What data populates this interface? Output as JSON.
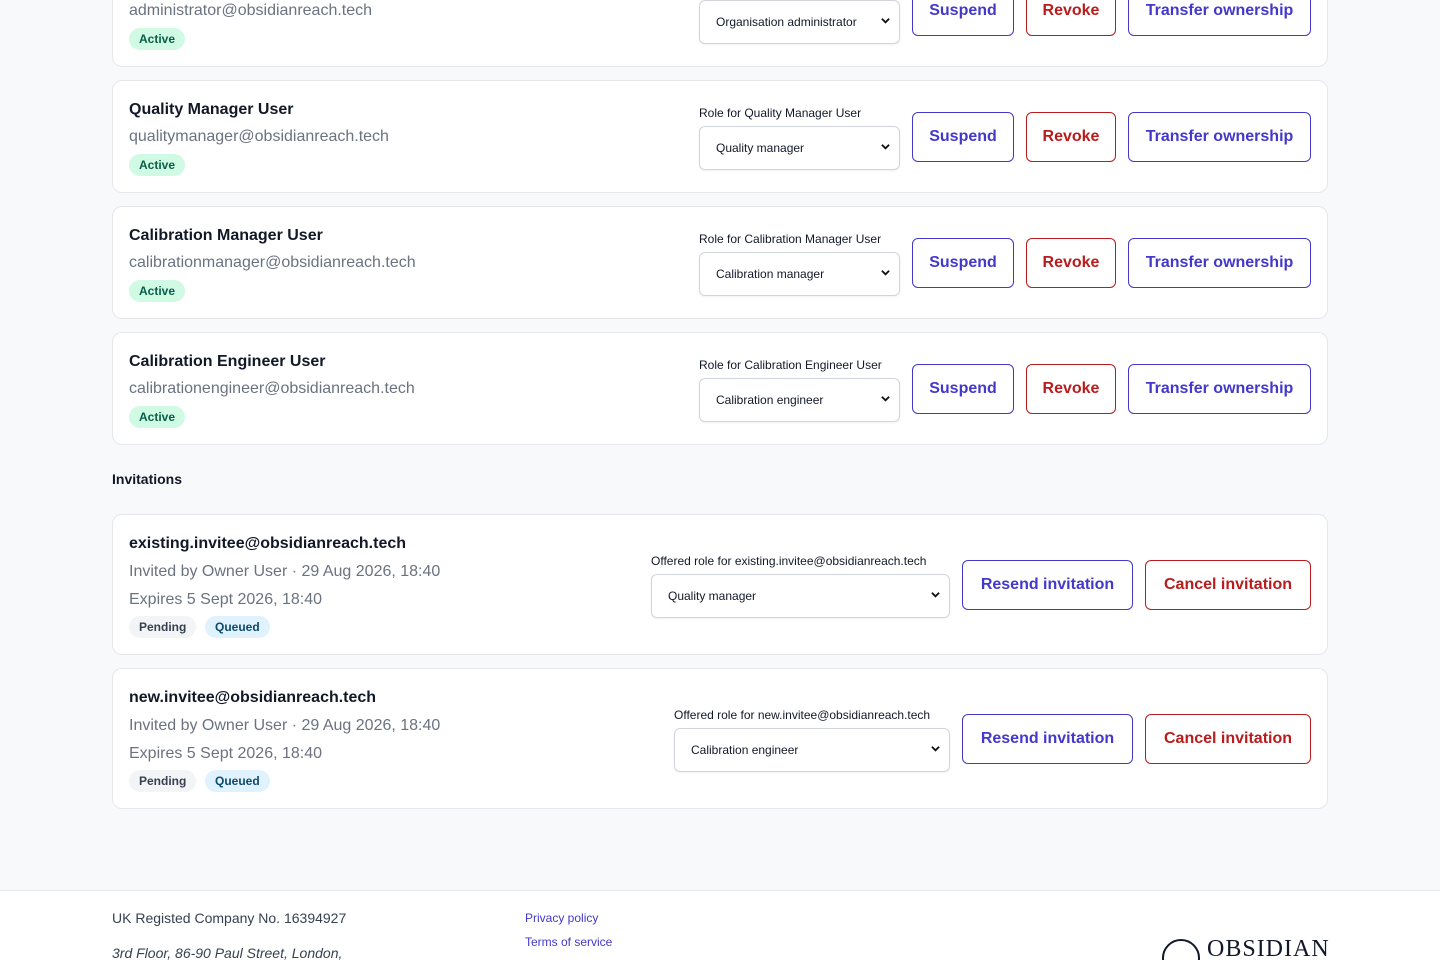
{
  "members": [
    {
      "name": "",
      "email": "administrator@obsidianreach.tech",
      "status": "Active",
      "role_label": "",
      "role": "Organisation administrator",
      "suspend": "Suspend",
      "revoke": "Revoke",
      "transfer": "Transfer ownership"
    },
    {
      "name": "Quality Manager User",
      "email": "qualitymanager@obsidianreach.tech",
      "status": "Active",
      "role_label": "Role for Quality Manager User",
      "role": "Quality manager",
      "suspend": "Suspend",
      "revoke": "Revoke",
      "transfer": "Transfer ownership"
    },
    {
      "name": "Calibration Manager User",
      "email": "calibrationmanager@obsidianreach.tech",
      "status": "Active",
      "role_label": "Role for Calibration Manager User",
      "role": "Calibration manager",
      "suspend": "Suspend",
      "revoke": "Revoke",
      "transfer": "Transfer ownership"
    },
    {
      "name": "Calibration Engineer User",
      "email": "calibrationengineer@obsidianreach.tech",
      "status": "Active",
      "role_label": "Role for Calibration Engineer User",
      "role": "Calibration engineer",
      "suspend": "Suspend",
      "revoke": "Revoke",
      "transfer": "Transfer ownership"
    }
  ],
  "invitations_title": "Invitations",
  "invitations": [
    {
      "email": "existing.invitee@obsidianreach.tech",
      "invited_by": "Invited by Owner User · 29 Aug 2026, 18:40",
      "expires": "Expires 5 Sept 2026, 18:40",
      "status": "Pending",
      "delivery": "Queued",
      "role_label": "Offered role for existing.invitee@obsidianreach.tech",
      "role": "Quality manager",
      "resend": "Resend invitation",
      "cancel": "Cancel invitation"
    },
    {
      "email": "new.invitee@obsidianreach.tech",
      "invited_by": "Invited by Owner User · 29 Aug 2026, 18:40",
      "expires": "Expires 5 Sept 2026, 18:40",
      "status": "Pending",
      "delivery": "Queued",
      "role_label": "Offered role for new.invitee@obsidianreach.tech",
      "role": "Calibration engineer",
      "resend": "Resend invitation",
      "cancel": "Cancel invitation"
    }
  ],
  "footer": {
    "company": "UK Registed Company No. 16394927",
    "address": "3rd Floor, 86-90 Paul Street, London,",
    "privacy": "Privacy policy",
    "terms": "Terms of service",
    "logo_text": "OBSIDIAN"
  },
  "icons": {
    "select_arrow": "chevron-down-icon",
    "logo_mark": "obsidian-logo-icon"
  },
  "colors": {
    "accent": "#4338ca",
    "danger": "#b91c1c",
    "active_badge_bg": "#d1fae5",
    "queued_badge_bg": "#e0f2fe"
  }
}
